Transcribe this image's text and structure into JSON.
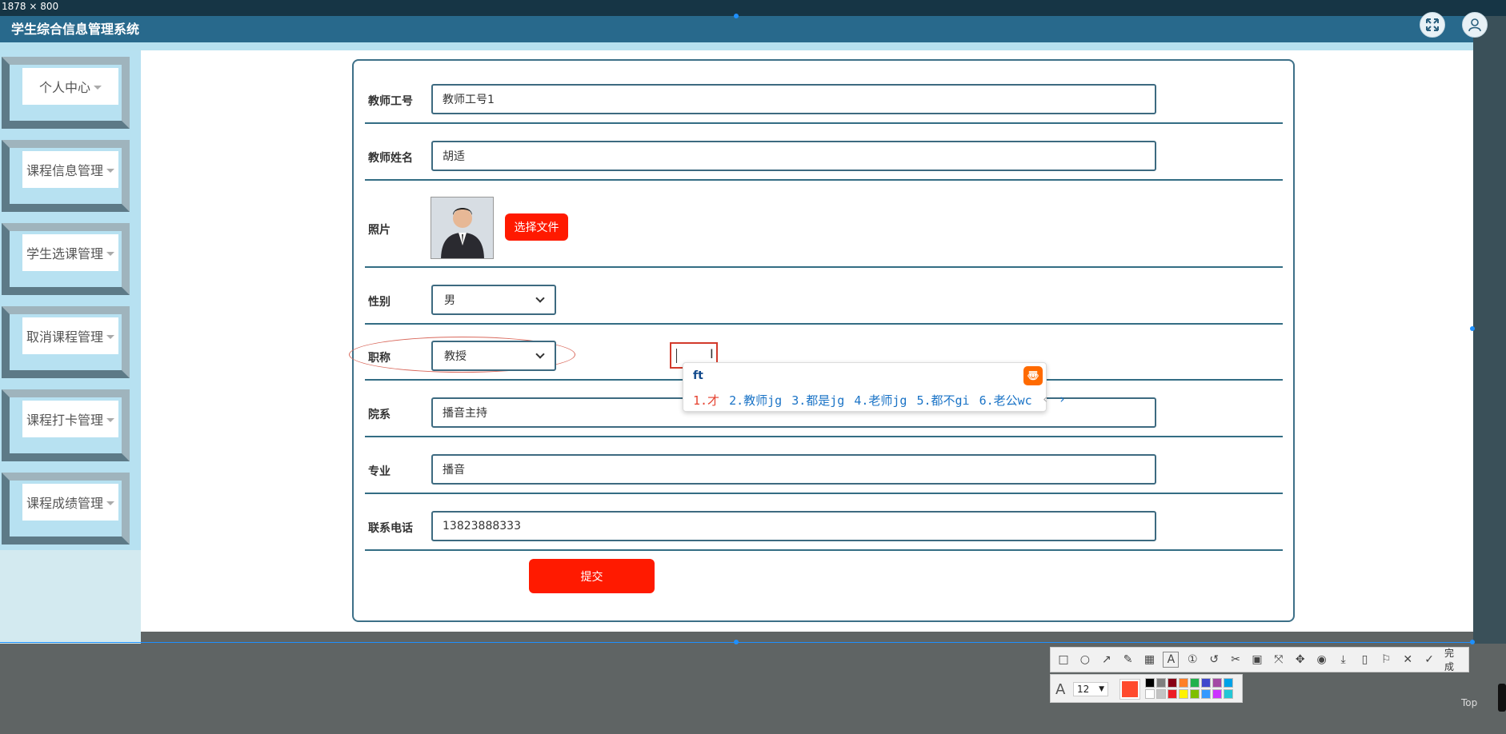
{
  "screenshot_tool": {
    "dimension_label": "1878 × 800",
    "font_size_value": "12",
    "done_label": "完成",
    "top_label": "Top",
    "palette": [
      "#000000",
      "#7f7f7f",
      "#880015",
      "#ff7f27",
      "#22b14c",
      "#3f48cc",
      "#a349a4",
      "#00a2e8",
      "#ffffff",
      "#c3c3c3",
      "#ed1c24",
      "#fff200",
      "#7fbf00",
      "#3399ff",
      "#cc33ff",
      "#22c6d6"
    ],
    "current_color": "#ff4a2d"
  },
  "header": {
    "title": "学生综合信息管理系统"
  },
  "sidebar": {
    "items": [
      {
        "label": "个人中心"
      },
      {
        "label": "课程信息管理"
      },
      {
        "label": "学生选课管理"
      },
      {
        "label": "取消课程管理"
      },
      {
        "label": "课程打卡管理"
      },
      {
        "label": "课程成绩管理"
      }
    ]
  },
  "form": {
    "teacher_id": {
      "label": "教师工号",
      "value": "教师工号1"
    },
    "teacher_name": {
      "label": "教师姓名",
      "value": "胡适"
    },
    "photo": {
      "label": "照片",
      "button": "选择文件"
    },
    "gender": {
      "label": "性别",
      "value": "男"
    },
    "title": {
      "label": "职称",
      "value": "教授"
    },
    "department": {
      "label": "院系",
      "value": "播音主持"
    },
    "major": {
      "label": "专业",
      "value": "播音"
    },
    "phone": {
      "label": "联系电话",
      "value": "13823888333"
    },
    "submit": "提交"
  },
  "ime": {
    "input": "ft",
    "logo": "〠",
    "candidates": [
      "1.才",
      "2.教师jg",
      "3.都是jg",
      "4.老师jg",
      "5.都不gi",
      "6.老公wc"
    ]
  }
}
